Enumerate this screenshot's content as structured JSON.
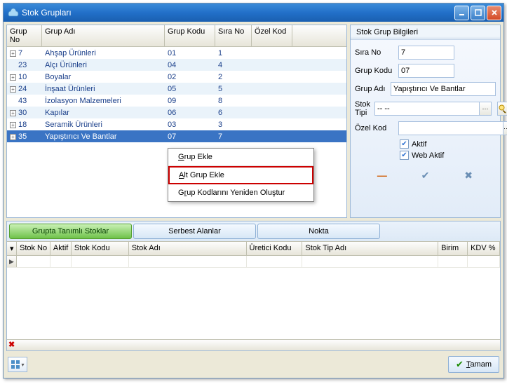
{
  "window": {
    "title": "Stok Grupları"
  },
  "grid": {
    "columns": {
      "no": "Grup No",
      "ad": "Grup Adı",
      "kod": "Grup Kodu",
      "sira": "Sıra No",
      "ozel": "Özel Kod"
    },
    "rows": [
      {
        "exp": true,
        "no": "7",
        "ad": "Ahşap Ürünleri",
        "kod": "01",
        "sira": "1",
        "striped": false
      },
      {
        "exp": false,
        "no": "23",
        "ad": "Alçı Ürünleri",
        "kod": "04",
        "sira": "4",
        "striped": true
      },
      {
        "exp": true,
        "no": "10",
        "ad": "Boyalar",
        "kod": "02",
        "sira": "2",
        "striped": false
      },
      {
        "exp": true,
        "no": "24",
        "ad": "İnşaat Ürünleri",
        "kod": "05",
        "sira": "5",
        "striped": true
      },
      {
        "exp": false,
        "no": "43",
        "ad": "İzolasyon Malzemeleri",
        "kod": "09",
        "sira": "8",
        "striped": false
      },
      {
        "exp": true,
        "no": "30",
        "ad": "Kapılar",
        "kod": "06",
        "sira": "6",
        "striped": true
      },
      {
        "exp": true,
        "no": "18",
        "ad": "Seramik Ürünleri",
        "kod": "03",
        "sira": "3",
        "striped": false
      },
      {
        "exp": true,
        "no": "35",
        "ad": "Yapıştırıcı Ve Bantlar",
        "kod": "07",
        "sira": "7",
        "striped": true,
        "selected": true
      }
    ]
  },
  "context_menu": {
    "items": {
      "grup_ekle": "Grup Ekle",
      "alt_grup_ekle": "Alt Grup Ekle",
      "yeniden": "Grup Kodlarını Yeniden Oluştur"
    }
  },
  "info": {
    "title": "Stok Grup Bilgileri",
    "labels": {
      "sira": "Sıra No",
      "kod": "Grup Kodu",
      "ad": "Grup Adı",
      "tip": "Stok Tipi",
      "ozel": "Özel Kod"
    },
    "values": {
      "sira": "7",
      "kod": "07",
      "ad": "Yapıştırıcı Ve Bantlar",
      "tip": "-- --",
      "ozel": ""
    },
    "checks": {
      "aktif": "Aktif",
      "web": "Web Aktif"
    }
  },
  "tabs": {
    "t1": "Grupta Tanımlı Stoklar",
    "t2": "Serbest Alanlar",
    "t3": "Nokta"
  },
  "lower_grid": {
    "columns": {
      "sno": "Stok No",
      "aktif": "Aktif",
      "skodu": "Stok Kodu",
      "sadi": "Stok Adı",
      "ukodu": "Üretici Kodu",
      "stip": "Stok Tip Adı",
      "birim": "Birim",
      "kdv": "KDV %"
    }
  },
  "buttons": {
    "tamam": "Tamam",
    "combo_ellipsis": "···"
  }
}
